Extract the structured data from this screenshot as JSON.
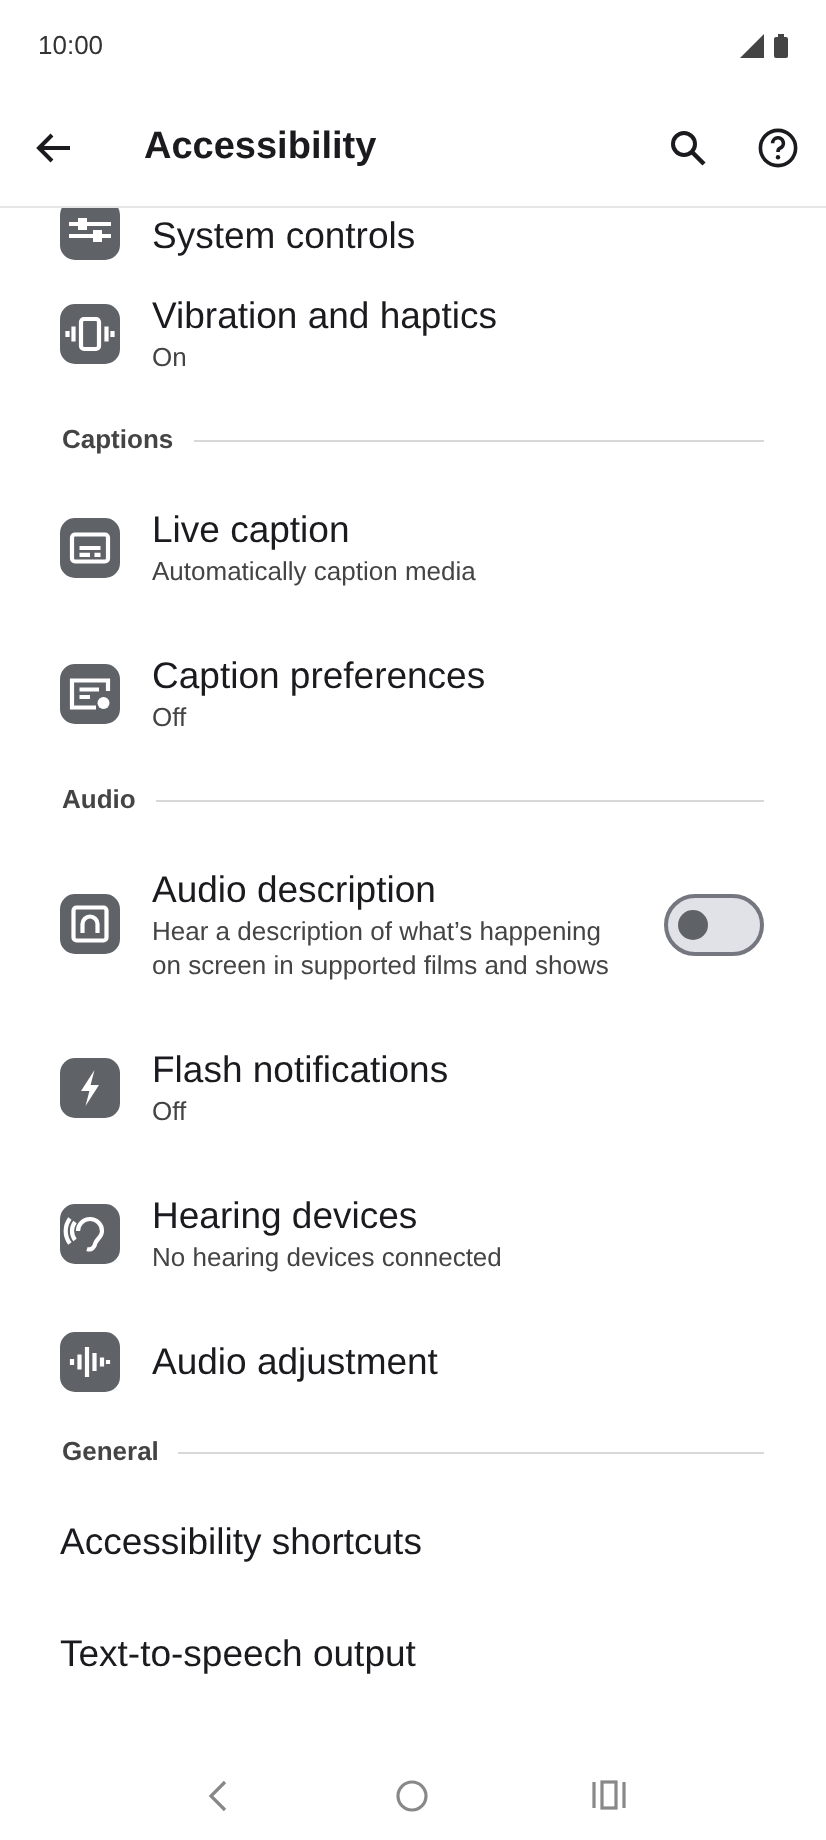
{
  "status_bar": {
    "time": "10:00"
  },
  "app_bar": {
    "title": "Accessibility"
  },
  "items": [
    {
      "kind": "setting",
      "title": "System controls"
    },
    {
      "kind": "setting",
      "title": "Vibration and haptics",
      "subtitle": "On"
    },
    {
      "kind": "header",
      "title": "Captions"
    },
    {
      "kind": "setting",
      "title": "Live caption",
      "subtitle": "Automatically caption media"
    },
    {
      "kind": "setting",
      "title": "Caption preferences",
      "subtitle": "Off"
    },
    {
      "kind": "header",
      "title": "Audio"
    },
    {
      "kind": "setting",
      "title": "Audio description",
      "subtitle": "Hear a description of what’s happening on screen in supported films and shows",
      "toggle": {
        "on": false
      }
    },
    {
      "kind": "setting",
      "title": "Flash notifications",
      "subtitle": "Off"
    },
    {
      "kind": "setting",
      "title": "Hearing devices",
      "subtitle": "No hearing devices connected"
    },
    {
      "kind": "setting",
      "title": "Audio adjustment"
    },
    {
      "kind": "header",
      "title": "General"
    },
    {
      "kind": "plain",
      "title": "Accessibility shortcuts"
    },
    {
      "kind": "plain",
      "title": "Text-to-speech output"
    }
  ]
}
